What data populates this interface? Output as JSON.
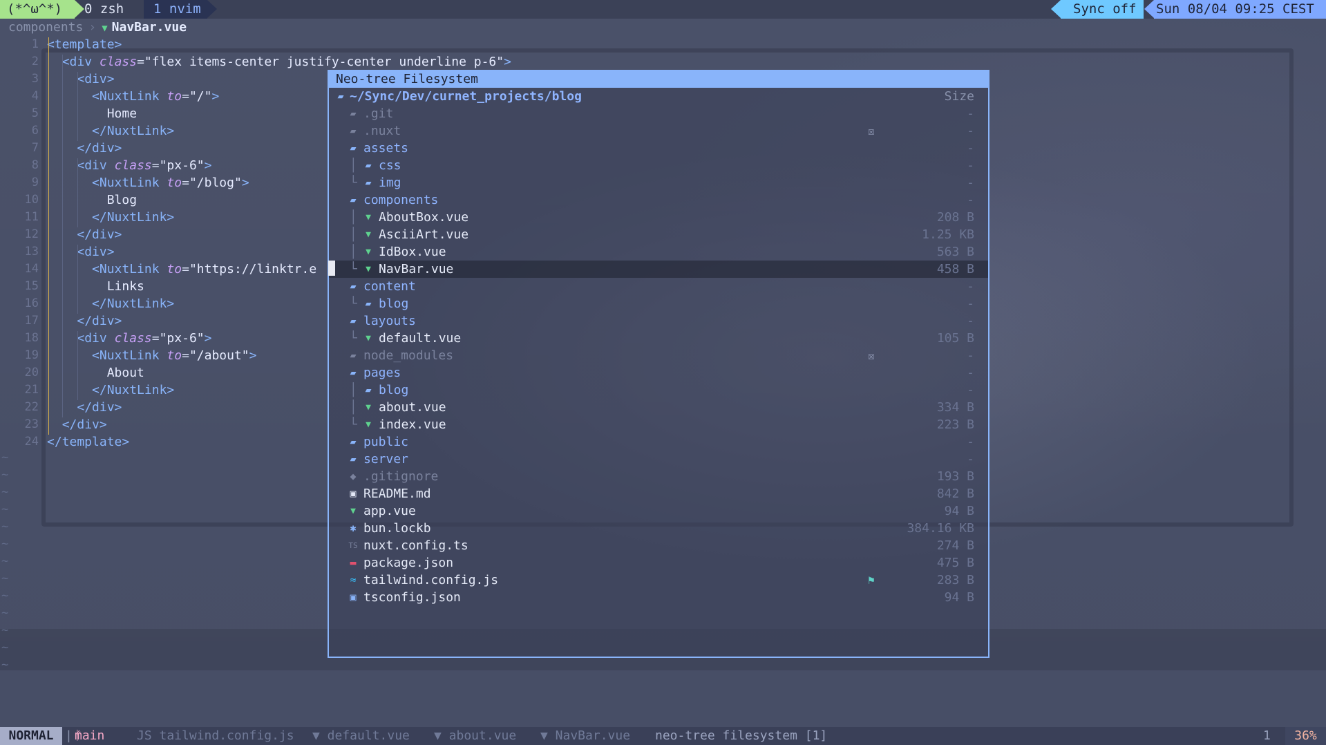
{
  "tmux": {
    "session": "(*^ω^*)",
    "window0": "0 zsh",
    "window1": "1 nvim",
    "sync": "Sync off",
    "datetime": "Sun 08/04 09:25 CEST"
  },
  "breadcrumb": {
    "folder": "components",
    "file": "NavBar.vue"
  },
  "code": [
    {
      "n": "1",
      "html": "<span class='tag'>&lt;template&gt;</span>"
    },
    {
      "n": "2",
      "html": "  <span class='tag'>&lt;div</span> <span class='attr'>class</span>=<span class='plain'>\"flex items-center justify-center underline p-6\"</span><span class='tag'>&gt;</span>"
    },
    {
      "n": "3",
      "html": "    <span class='tag'>&lt;div&gt;</span>"
    },
    {
      "n": "4",
      "html": "      <span class='tag'>&lt;NuxtLink</span> <span class='attr'>to</span>=<span class='plain'>\"/\"</span><span class='tag'>&gt;</span>"
    },
    {
      "n": "5",
      "html": "        <span class='plain'>Home</span>"
    },
    {
      "n": "6",
      "html": "      <span class='tag'>&lt;/NuxtLink&gt;</span>"
    },
    {
      "n": "7",
      "html": "    <span class='tag'>&lt;/div&gt;</span>"
    },
    {
      "n": "8",
      "html": "    <span class='tag'>&lt;div</span> <span class='attr'>class</span>=<span class='plain'>\"px-6\"</span><span class='tag'>&gt;</span>"
    },
    {
      "n": "9",
      "html": "      <span class='tag'>&lt;NuxtLink</span> <span class='attr'>to</span>=<span class='plain'>\"/blog\"</span><span class='tag'>&gt;</span>"
    },
    {
      "n": "10",
      "html": "        <span class='plain'>Blog</span>"
    },
    {
      "n": "11",
      "html": "      <span class='tag'>&lt;/NuxtLink&gt;</span>"
    },
    {
      "n": "12",
      "html": "    <span class='tag'>&lt;/div&gt;</span>"
    },
    {
      "n": "13",
      "html": "    <span class='tag'>&lt;div&gt;</span>"
    },
    {
      "n": "14",
      "html": "      <span class='tag'>&lt;NuxtLink</span> <span class='attr'>to</span>=<span class='plain'>\"https://linktr.e</span>"
    },
    {
      "n": "15",
      "html": "        <span class='plain'>Links</span>"
    },
    {
      "n": "16",
      "html": "      <span class='tag'>&lt;/NuxtLink&gt;</span>"
    },
    {
      "n": "17",
      "html": "    <span class='tag'>&lt;/div&gt;</span>"
    },
    {
      "n": "18",
      "html": "    <span class='tag'>&lt;div</span> <span class='attr'>class</span>=<span class='plain'>\"px-6\"</span><span class='tag'>&gt;</span>"
    },
    {
      "n": "19",
      "html": "      <span class='tag'>&lt;NuxtLink</span> <span class='attr'>to</span>=<span class='plain'>\"/about\"</span><span class='tag'>&gt;</span>"
    },
    {
      "n": "20",
      "html": "        <span class='plain'>About</span>"
    },
    {
      "n": "21",
      "html": "      <span class='tag'>&lt;/NuxtLink&gt;</span>"
    },
    {
      "n": "22",
      "html": "    <span class='tag'>&lt;/div&gt;</span>"
    },
    {
      "n": "23",
      "html": "  <span class='tag'>&lt;/div&gt;</span>"
    },
    {
      "n": "24",
      "html": "<span class='tag'>&lt;/template&gt;</span>"
    }
  ],
  "neotree": {
    "title": "Neo-tree Filesystem",
    "root": "~/Sync/Dev/curnet_projects/blog",
    "size_header": "Size",
    "rows": [
      {
        "depth": 0,
        "kind": "folder-dim",
        "name": ".git",
        "size": "-"
      },
      {
        "depth": 0,
        "kind": "folder-dim",
        "name": ".nuxt",
        "size": "-",
        "git": "☒"
      },
      {
        "depth": 0,
        "kind": "folder-open",
        "name": "assets",
        "size": "-"
      },
      {
        "depth": 1,
        "kind": "folder",
        "name": "css",
        "size": "-",
        "branch": "│"
      },
      {
        "depth": 1,
        "kind": "folder",
        "name": "img",
        "size": "-",
        "branch": "└"
      },
      {
        "depth": 0,
        "kind": "folder-open",
        "name": "components",
        "size": "-"
      },
      {
        "depth": 1,
        "kind": "vue",
        "name": "AboutBox.vue",
        "size": "208 B",
        "branch": "│"
      },
      {
        "depth": 1,
        "kind": "vue",
        "name": "AsciiArt.vue",
        "size": "1.25 KB",
        "branch": "│"
      },
      {
        "depth": 1,
        "kind": "vue",
        "name": "IdBox.vue",
        "size": "563 B",
        "branch": "│"
      },
      {
        "depth": 1,
        "kind": "vue",
        "name": "NavBar.vue",
        "size": "458 B",
        "branch": "└",
        "selected": true
      },
      {
        "depth": 0,
        "kind": "folder-open",
        "name": "content",
        "size": "-"
      },
      {
        "depth": 1,
        "kind": "folder",
        "name": "blog",
        "size": "-",
        "branch": "└"
      },
      {
        "depth": 0,
        "kind": "folder-open",
        "name": "layouts",
        "size": "-"
      },
      {
        "depth": 1,
        "kind": "vue",
        "name": "default.vue",
        "size": "105 B",
        "branch": "└"
      },
      {
        "depth": 0,
        "kind": "folder-dim",
        "name": "node_modules",
        "size": "-",
        "git": "☒"
      },
      {
        "depth": 0,
        "kind": "folder-open",
        "name": "pages",
        "size": "-"
      },
      {
        "depth": 1,
        "kind": "folder",
        "name": "blog",
        "size": "-",
        "branch": "│"
      },
      {
        "depth": 1,
        "kind": "vue",
        "name": "about.vue",
        "size": "334 B",
        "branch": "│"
      },
      {
        "depth": 1,
        "kind": "vue",
        "name": "index.vue",
        "size": "223 B",
        "branch": "└"
      },
      {
        "depth": 0,
        "kind": "folder",
        "name": "public",
        "size": "-"
      },
      {
        "depth": 0,
        "kind": "folder",
        "name": "server",
        "size": "-"
      },
      {
        "depth": 0,
        "kind": "git",
        "name": ".gitignore",
        "size": "193 B"
      },
      {
        "depth": 0,
        "kind": "md",
        "name": "README.md",
        "size": "842 B"
      },
      {
        "depth": 0,
        "kind": "vue",
        "name": "app.vue",
        "size": "94 B"
      },
      {
        "depth": 0,
        "kind": "star",
        "name": "bun.lockb",
        "size": "384.16 KB"
      },
      {
        "depth": 0,
        "kind": "ts",
        "name": "nuxt.config.ts",
        "size": "274 B"
      },
      {
        "depth": 0,
        "kind": "npm",
        "name": "package.json",
        "size": "475 B"
      },
      {
        "depth": 0,
        "kind": "tw",
        "name": "tailwind.config.js",
        "size": "283 B",
        "git": "⚑"
      },
      {
        "depth": 0,
        "kind": "tsjson",
        "name": "tsconfig.json",
        "size": "94 B"
      }
    ]
  },
  "statusline": {
    "mode": "NORMAL",
    "branch": "main",
    "buffers": [
      "JS tailwind.config.js",
      "▼ default.vue",
      "▼ about.vue",
      "▼ NavBar.vue"
    ],
    "filetype": "neo-tree filesystem [1]",
    "line": "1",
    "percent": "36%"
  },
  "colors": {
    "accent": "#89b4fa",
    "vue": "#5fd38f",
    "mode_bg": "#a6adc8",
    "session": "#a6e38c"
  }
}
